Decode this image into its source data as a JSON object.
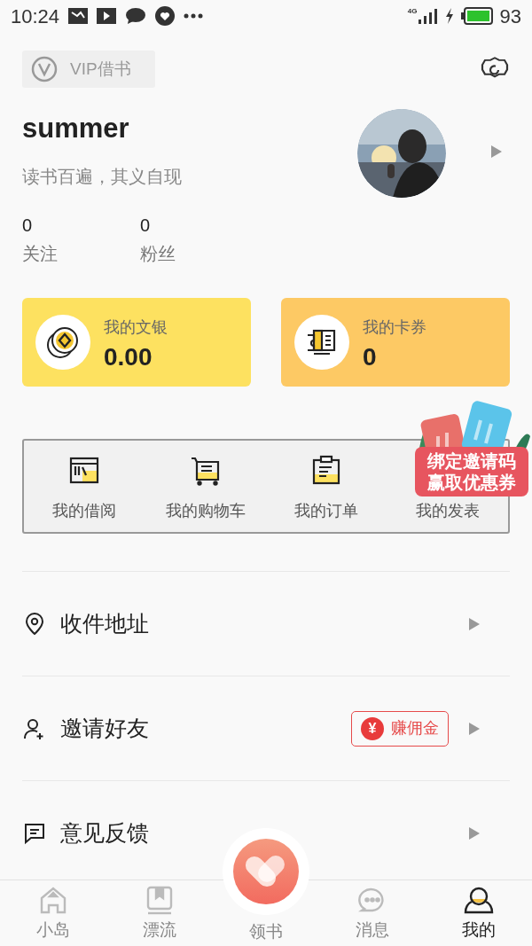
{
  "status_bar": {
    "time": "10:24",
    "network": "4G",
    "battery": "93"
  },
  "header": {
    "vip_label": "VIP借书"
  },
  "profile": {
    "name": "summer",
    "motto": "读书百遍，其义自现",
    "stats": [
      {
        "value": "0",
        "label": "关注"
      },
      {
        "value": "0",
        "label": "粉丝"
      }
    ]
  },
  "wallet_cards": [
    {
      "kind": "coins",
      "title": "我的文银",
      "value": "0.00",
      "color": "#fde160"
    },
    {
      "kind": "tickets",
      "title": "我的卡券",
      "value": "0",
      "color": "#fdc964"
    }
  ],
  "shortcuts": [
    {
      "kind": "shelf",
      "label": "我的借阅"
    },
    {
      "kind": "cart",
      "label": "我的购物车"
    },
    {
      "kind": "clipboard",
      "label": "我的订单"
    },
    {
      "kind": "hidden",
      "label": "我的发表"
    }
  ],
  "promo_badge": {
    "lines": [
      "绑定邀请码",
      "赢取优惠券"
    ]
  },
  "menu": [
    {
      "kind": "pin",
      "label": "收件地址"
    },
    {
      "kind": "person-add",
      "label": "邀请好友",
      "badge": {
        "symbol": "¥",
        "text": "赚佣金"
      }
    },
    {
      "kind": "feedback",
      "label": "意见反馈"
    }
  ],
  "bottom_nav": [
    {
      "kind": "home",
      "label": "小岛",
      "selected": false
    },
    {
      "kind": "book",
      "label": "漂流",
      "selected": false
    },
    {
      "kind": "center",
      "label": "领书",
      "selected": false
    },
    {
      "kind": "chat",
      "label": "消息",
      "selected": false
    },
    {
      "kind": "me",
      "label": "我的",
      "selected": true
    }
  ]
}
